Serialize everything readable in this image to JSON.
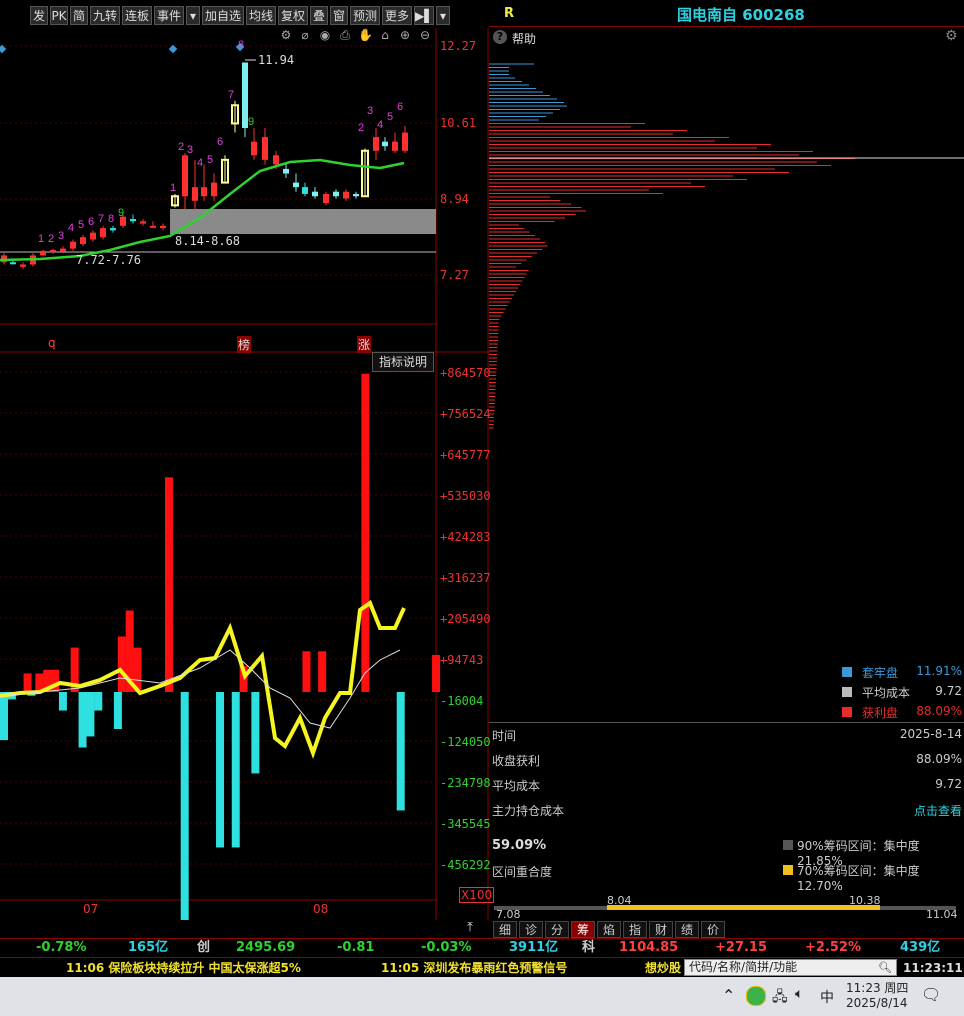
{
  "toolbar": {
    "buttons": [
      "发",
      "PK",
      "简",
      "九转",
      "连板",
      "事件",
      "▾",
      "加自选",
      "均线",
      "复权",
      "叠",
      "窗",
      "预测",
      "更多",
      "▶▌",
      "▾"
    ]
  },
  "stock": {
    "r_label": "R",
    "title": "国电南自 600268"
  },
  "help_label": "帮助",
  "price_axis": [
    "12.27",
    "10.61",
    "8.94",
    "7.27"
  ],
  "annotations": {
    "high_label": "11.94",
    "zone1": "8.14-8.68",
    "zone2": "7.72-7.76",
    "markers": [
      "q",
      "榜",
      "涨"
    ]
  },
  "indicator": {
    "title": "指标说明",
    "multiplier": "X100",
    "axis": [
      "+864570",
      "+756524",
      "+645777",
      "+535030",
      "+424283",
      "+316237",
      "+205490",
      "+94743",
      "-16004",
      "-124050",
      "-234798",
      "-345545",
      "-456292"
    ],
    "months": [
      "07",
      "08"
    ]
  },
  "chart_data": {
    "type": "bar",
    "title": "",
    "ylabel": "",
    "multiplier": "X100",
    "ylim": [
      -500000,
      900000
    ],
    "values": [
      -130000,
      0,
      -20000,
      0,
      0,
      0,
      50000,
      -10000,
      0,
      50000,
      0,
      60000,
      40000,
      60000,
      0,
      -50000,
      0,
      0,
      120000,
      0,
      -150000,
      0,
      -120000,
      0,
      -50000,
      0,
      0,
      0,
      0,
      -100000,
      150000,
      0,
      220000,
      0,
      120000,
      0,
      0,
      0,
      0,
      0,
      0,
      0,
      580000,
      0,
      0,
      0,
      -700000,
      0,
      0,
      0,
      0,
      0,
      0,
      0,
      0,
      -420000,
      0,
      0,
      0,
      -420000,
      0,
      70000,
      0,
      0,
      -220000,
      0,
      0,
      0,
      0,
      0,
      0,
      0,
      0,
      0,
      0,
      0,
      0,
      110000,
      0,
      0,
      0,
      110000,
      0,
      0,
      0,
      0,
      0,
      0,
      0,
      0,
      0,
      0,
      860000,
      0,
      0,
      0,
      0,
      0,
      0,
      0,
      0,
      -320000,
      0,
      0,
      0,
      0,
      0,
      0,
      0,
      0,
      100000
    ]
  },
  "chip_legend": [
    {
      "label": "套牢盘",
      "value": "11.91%",
      "color": "#3a9ad9"
    },
    {
      "label": "平均成本",
      "value": "9.72",
      "color": "#bbbbbb"
    },
    {
      "label": "获利盘",
      "value": "88.09%",
      "color": "#e82b2b"
    }
  ],
  "chip_info": {
    "time_label": "时间",
    "time_value": "2025-8-14",
    "profit_label": "收盘获利",
    "profit_value": "88.09%",
    "avg_label": "平均成本",
    "avg_value": "9.72",
    "main_label": "主力持仓成本",
    "main_value": "点击查看",
    "overlap_pct": "59.09%",
    "overlap_label": "区间重合度",
    "range90": "90%筹码区间：集中度21.85%",
    "range70": "70%筹码区间：集中度12.70%",
    "bar_min": "7.08",
    "bar_max": "11.04",
    "bar_low": "8.04",
    "bar_high": "10.38"
  },
  "right_tabs": [
    "细",
    "诊",
    "分",
    "筹",
    "焰",
    "指",
    "财",
    "绩",
    "价"
  ],
  "status": [
    {
      "text": "-0.78%",
      "color": "#2fd12f"
    },
    {
      "text": "165亿",
      "color": "#2fd1e0"
    },
    {
      "text": "创",
      "color": "#cccccc"
    },
    {
      "text": "2495.69",
      "color": "#2fd12f"
    },
    {
      "text": "-0.81",
      "color": "#2fd12f"
    },
    {
      "text": "-0.03%",
      "color": "#2fd12f"
    },
    {
      "text": "3911亿",
      "color": "#2fd1e0"
    },
    {
      "text": "科",
      "color": "#cccccc"
    },
    {
      "text": "1104.85",
      "color": "#ff4040"
    },
    {
      "text": "+27.15",
      "color": "#ff4040"
    },
    {
      "text": "+2.52%",
      "color": "#ff4040"
    },
    {
      "text": "439亿",
      "color": "#2fd1e0"
    }
  ],
  "ticker": {
    "news1": "11:06 保险板块持续拉升 中国太保涨超5%",
    "news2": "11:05 深圳发布暴雨红色预警信号",
    "news3": "想炒股",
    "search_placeholder": "代码/名称/简拼/功能",
    "clock": "11:23:11"
  },
  "taskbar": {
    "ime": "中",
    "time": "11:23 周四",
    "date": "2025/8/14"
  }
}
